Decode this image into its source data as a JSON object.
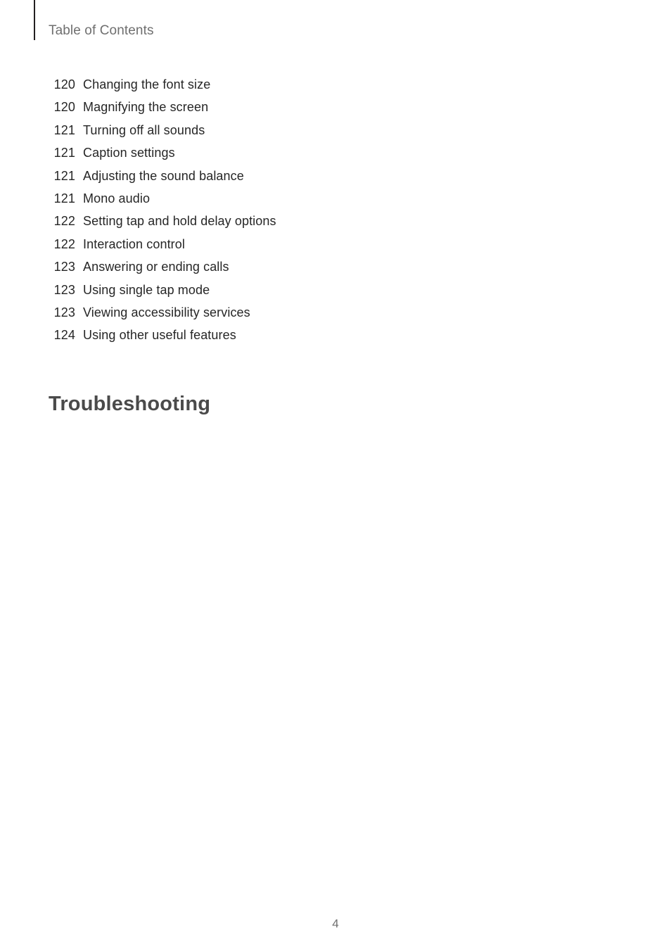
{
  "header": {
    "title": "Table of Contents"
  },
  "toc": {
    "entries": [
      {
        "page": "120",
        "label": "Changing the font size"
      },
      {
        "page": "120",
        "label": "Magnifying the screen"
      },
      {
        "page": "121",
        "label": "Turning off all sounds"
      },
      {
        "page": "121",
        "label": "Caption settings"
      },
      {
        "page": "121",
        "label": "Adjusting the sound balance"
      },
      {
        "page": "121",
        "label": "Mono audio"
      },
      {
        "page": "122",
        "label": "Setting tap and hold delay options"
      },
      {
        "page": "122",
        "label": "Interaction control"
      },
      {
        "page": "123",
        "label": "Answering or ending calls"
      },
      {
        "page": "123",
        "label": "Using single tap mode"
      },
      {
        "page": "123",
        "label": "Viewing accessibility services"
      },
      {
        "page": "124",
        "label": "Using other useful features"
      }
    ]
  },
  "chapter": {
    "title": "Troubleshooting"
  },
  "footer": {
    "page_number": "4"
  },
  "colors": {
    "header_text": "#6f6f6f",
    "body_text": "#262626",
    "chapter_text": "#4a4a4a",
    "rule": "#231f20",
    "background": "#ffffff"
  }
}
